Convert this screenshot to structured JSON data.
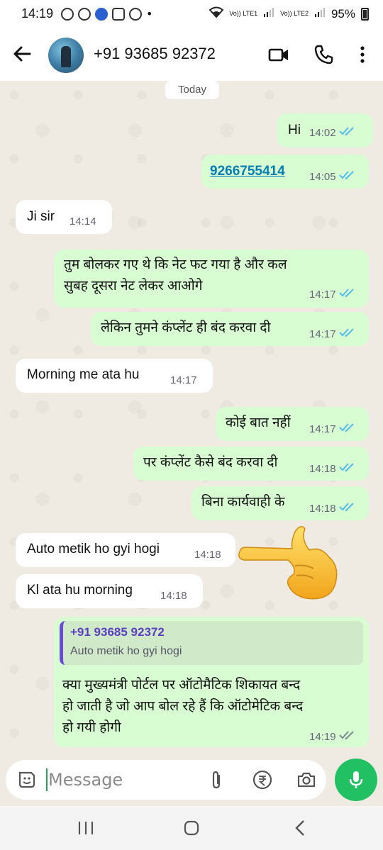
{
  "status": {
    "time": "14:19",
    "net1": "Vo)) LTE1",
    "net2": "Vo)) LTE2",
    "battery": "95%",
    "notification_icons": [
      "whatsapp-icon",
      "whatsapp-icon",
      "bluetooth-icon",
      "paytm-icon",
      "location-icon"
    ]
  },
  "header": {
    "title": "+91 93685 92372"
  },
  "chat": {
    "date": "Today",
    "messages": [
      {
        "dir": "out",
        "text": "Hi",
        "time": "14:02",
        "ticks": "read"
      },
      {
        "dir": "out",
        "text": "9266755414",
        "time": "14:05",
        "ticks": "read"
      },
      {
        "dir": "in",
        "text": "Ji sir",
        "time": "14:14"
      },
      {
        "dir": "out",
        "line1": "तुम बोलकर गए थे कि नेट फट गया है और कल",
        "line2": "सुबह दूसरा नेट लेकर आओगे",
        "time": "14:17",
        "ticks": "read"
      },
      {
        "dir": "out",
        "text": "लेकिन तुमने कंप्लेंट ही बंद करवा दी",
        "time": "14:17",
        "ticks": "read"
      },
      {
        "dir": "in",
        "text": "Morning me ata hu",
        "time": "14:17"
      },
      {
        "dir": "out",
        "text": "कोई बात नहीं",
        "time": "14:17",
        "ticks": "read"
      },
      {
        "dir": "out",
        "text": "पर कंप्लेंट कैसे बंद करवा दी",
        "time": "14:18",
        "ticks": "read"
      },
      {
        "dir": "out",
        "text": "बिना कार्यवाही के",
        "time": "14:18",
        "ticks": "read"
      },
      {
        "dir": "in",
        "text": "Auto metik ho gyi hogi",
        "time": "14:18"
      },
      {
        "dir": "in",
        "text": "Kl ata hu morning",
        "time": "14:18"
      },
      {
        "dir": "out",
        "quote_name": "+91 93685 92372",
        "quote_text": "Auto metik ho gyi hogi",
        "line1": "क्या मुख्यमंत्री पोर्टल पर ऑटोमैटिक शिकायत बन्द",
        "line2": "हो जाती है जो आप बोल रहे हैं कि ऑटोमेटिक बन्द",
        "line3": "हो गयी होगी",
        "time": "14:19",
        "ticks": "delivered"
      }
    ]
  },
  "composer": {
    "placeholder": "Message"
  },
  "colors": {
    "outgoing_bubble": "#d9fdd3",
    "incoming_bubble": "#ffffff",
    "read_tick": "#53bdeb",
    "send_button": "#21c063",
    "background": "#efeae2"
  }
}
